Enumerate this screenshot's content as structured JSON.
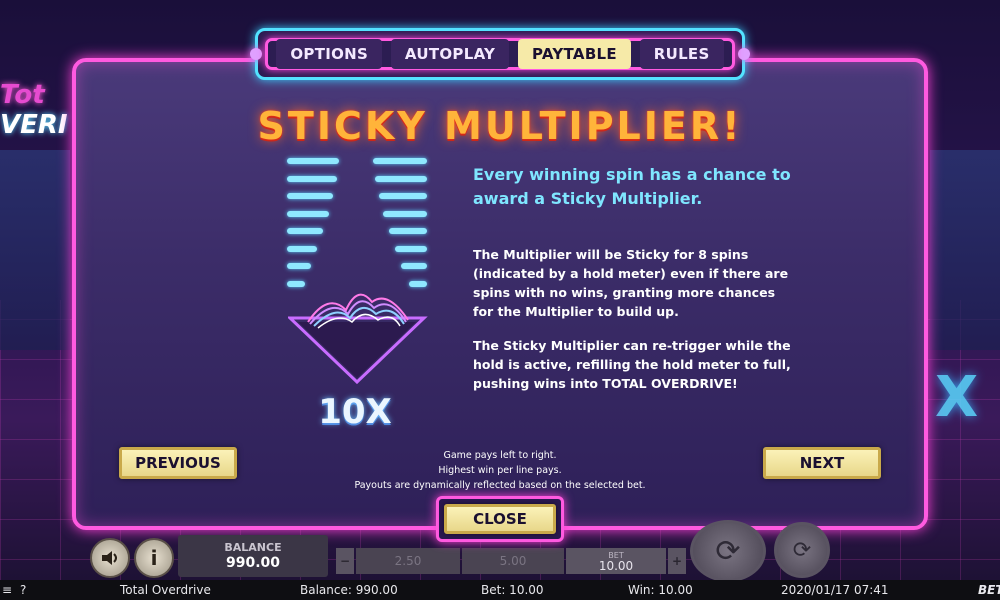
{
  "background": {
    "logo_line1": "Tot",
    "logo_line2": "VERI",
    "deco_x": "X"
  },
  "tabs": [
    {
      "label": "OPTIONS",
      "active": false
    },
    {
      "label": "AUTOPLAY",
      "active": false
    },
    {
      "label": "PAYTABLE",
      "active": true
    },
    {
      "label": "RULES",
      "active": false
    }
  ],
  "feature": {
    "title": "STICKY MULTIPLIER!",
    "multiplier": "10X",
    "headline": "Every winning spin has a chance to award a Sticky Multiplier.",
    "para1": "The Multiplier will be Sticky for 8 spins (indicated by a hold meter) even if there are spins with no wins, granting more chances for the Multiplier to build up.",
    "para2": "The Sticky Multiplier can re-trigger while the hold is active, refilling the hold meter to full, pushing wins into TOTAL OVERDRIVE!"
  },
  "notes": {
    "line1": "Game pays left to right.",
    "line2": "Highest win per line pays.",
    "line3": "Payouts are dynamically reflected based on the selected bet."
  },
  "buttons": {
    "previous": "PREVIOUS",
    "next": "NEXT",
    "close": "CLOSE"
  },
  "hud": {
    "sound_icon": "speaker-icon",
    "info_icon": "info-icon",
    "info_glyph": "i",
    "balance_label": "BALANCE",
    "balance_value": "990.00",
    "bet_minus": "−",
    "bet_plus": "+",
    "bet_options": [
      "2.50",
      "5.00"
    ],
    "bet_label": "BET",
    "bet_value": "10.00"
  },
  "status": {
    "menu": "≡",
    "help": "?",
    "game": "Total Overdrive",
    "balance": "Balance: 990.00",
    "bet": "Bet: 10.00",
    "win": "Win: 10.00",
    "datetime": "2020/01/17 07:41",
    "brand": "BET"
  },
  "colors": {
    "neon_pink": "#ff5ae0",
    "neon_cyan": "#53e3ff",
    "title_orange": "#ffb43a",
    "button_cream": "#fbf2b8"
  }
}
